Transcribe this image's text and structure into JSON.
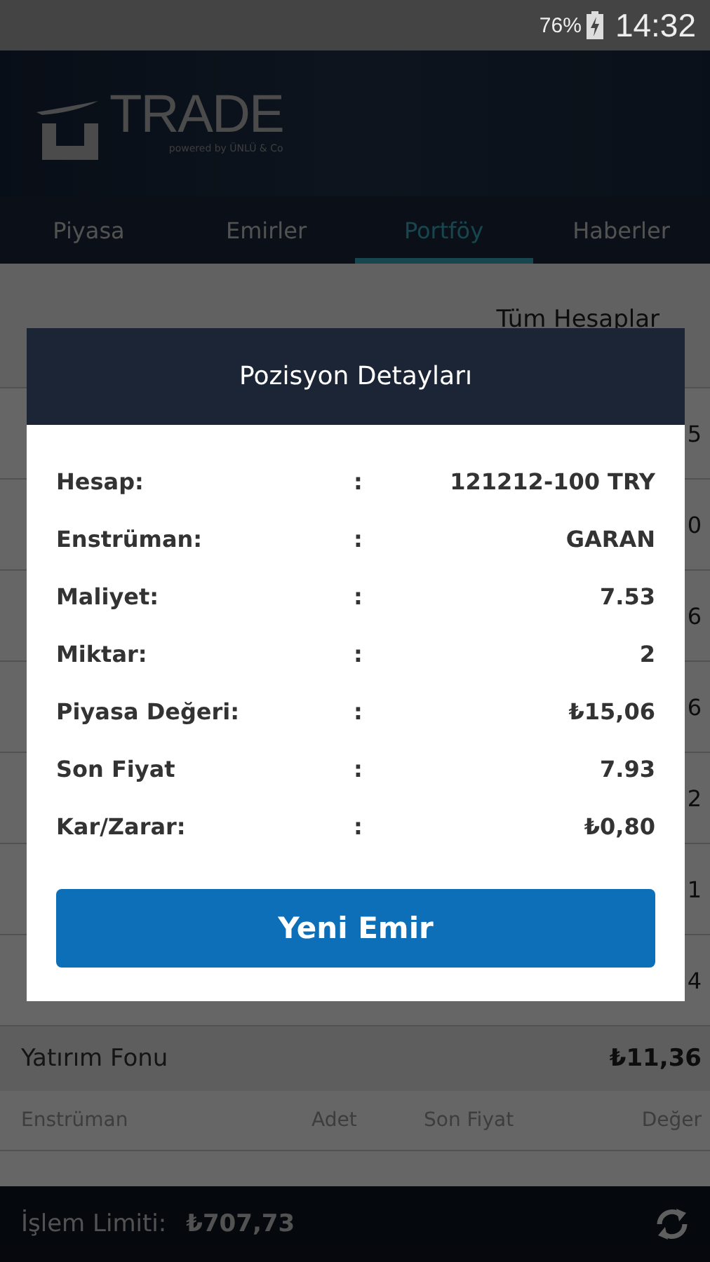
{
  "status_bar": {
    "battery": "76%",
    "time": "14:32"
  },
  "header": {
    "logo_text": "TRADE",
    "logo_tagline": "powered by ÜNLÜ & Co"
  },
  "tabs": [
    {
      "label": "Piyasa",
      "selected": false
    },
    {
      "label": "Emirler",
      "selected": false
    },
    {
      "label": "Portföy",
      "selected": true
    },
    {
      "label": "Haberler",
      "selected": false
    }
  ],
  "account_filter": "Tüm Hesaplar",
  "background_rows": [
    {
      "column_4": "5"
    },
    {
      "column_4": "0"
    },
    {
      "column_4": "6"
    },
    {
      "column_4": "6"
    },
    {
      "column_4": "2"
    },
    {
      "column_4": "1"
    },
    {
      "column_4": "4"
    }
  ],
  "fund_section": {
    "title": "Yatırım Fonu",
    "total": "₺11,36",
    "columns": [
      "Enstrüman",
      "Adet",
      "Son Fiyat",
      "Değer"
    ]
  },
  "dialog": {
    "title": "Pozisyon Detayları",
    "fields": [
      {
        "label": "Hesap:",
        "separator": ":",
        "value": "121212-100 TRY"
      },
      {
        "label": "Enstrüman:",
        "separator": ":",
        "value": "GARAN"
      },
      {
        "label": "Maliyet:",
        "separator": ":",
        "value": "7.53"
      },
      {
        "label": "Miktar:",
        "separator": ":",
        "value": "2"
      },
      {
        "label": "Piyasa Değeri:",
        "separator": ":",
        "value": "₺15,06"
      },
      {
        "label": "Son Fiyat",
        "separator": ":",
        "value": "7.93"
      },
      {
        "label": "Kar/Zarar:",
        "separator": ":",
        "value": "₺0,80"
      }
    ],
    "button": "Yeni Emir"
  },
  "bottom_bar": {
    "label": "İşlem Limiti:",
    "value": "₺707,73"
  }
}
